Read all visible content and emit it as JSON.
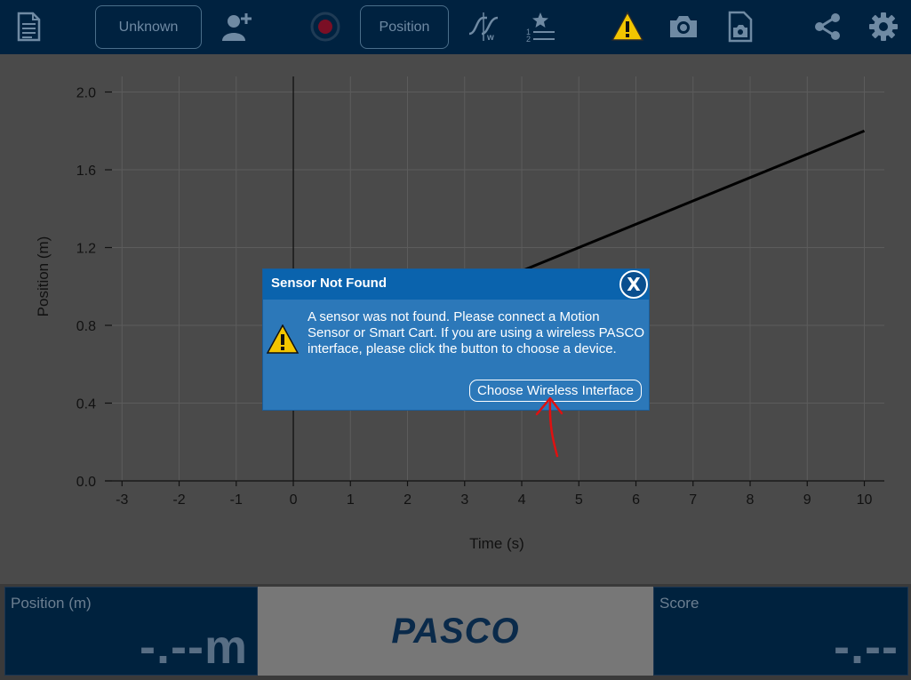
{
  "toolbar": {
    "sensor_label": "Unknown",
    "measurement_label": "Position",
    "icons": [
      "document-icon",
      "add-user-icon",
      "record-icon",
      "curve-fit-icon",
      "ranking-icon",
      "warning-icon",
      "camera-icon",
      "snapshot-icon",
      "share-icon",
      "settings-icon"
    ],
    "warning_color": "#f2c500"
  },
  "chart_data": {
    "type": "line",
    "xlabel": "Time (s)",
    "ylabel": "Position (m)",
    "xlim": [
      -3.3,
      10.35
    ],
    "ylim": [
      0,
      2.08
    ],
    "x_ticks": [
      "-3",
      "-2",
      "-1",
      "0",
      "1",
      "2",
      "3",
      "4",
      "5",
      "6",
      "7",
      "8",
      "9",
      "10"
    ],
    "y_ticks": [
      "0.0",
      "0.4",
      "0.8",
      "1.2",
      "1.6",
      "2.0"
    ],
    "grid": true,
    "series": [
      {
        "x": [
          0,
          10
        ],
        "y": [
          0.6,
          1.8
        ]
      }
    ]
  },
  "dialog": {
    "title": "Sensor Not Found",
    "message": "A sensor was not found. Please connect a Motion Sensor or Smart Cart. If you are using a wireless PASCO interface, please click the button to choose a device.",
    "button_label": "Choose Wireless Interface",
    "close_label": "X"
  },
  "bottom": {
    "left_label": "Position (m)",
    "left_value": "-.--m",
    "logo": "PASCO",
    "right_label": "Score",
    "right_value": "-.--"
  },
  "colors": {
    "toolbar_bg": "#002240",
    "dialog_header": "#0a63ad",
    "dialog_body": "#2c78b9",
    "annotation": "#e01010"
  }
}
